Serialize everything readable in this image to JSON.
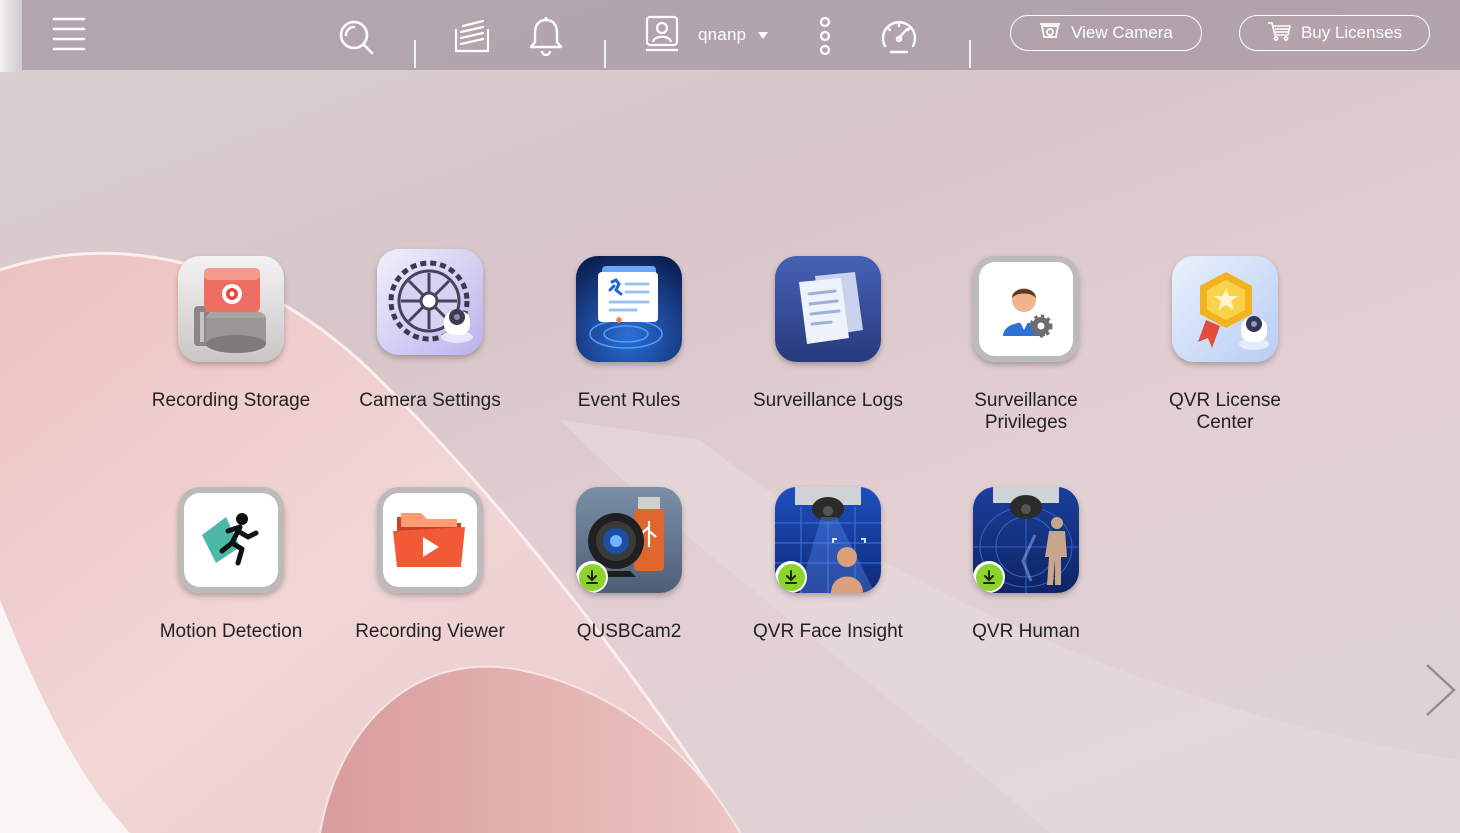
{
  "topbar": {
    "menu_icon": "hamburger-menu-icon",
    "search_icon": "search-icon",
    "tasks_icon": "background-tasks-icon",
    "notifications_icon": "bell-icon",
    "user": {
      "name": "qnanp",
      "icon": "user-icon"
    },
    "more_icon": "more-vertical-icon",
    "dashboard_icon": "dashboard-gauge-icon",
    "view_camera_label": "View Camera",
    "buy_licenses_label": "Buy Licenses"
  },
  "apps": [
    {
      "label": "Recording Storage",
      "icon": "recording-storage-icon"
    },
    {
      "label": "Camera Settings",
      "icon": "camera-settings-icon"
    },
    {
      "label": "Event Rules",
      "icon": "event-rules-icon"
    },
    {
      "label": "Surveillance Logs",
      "icon": "surveillance-logs-icon"
    },
    {
      "label": "Surveillance Privileges",
      "label_line1": "Surveillance",
      "label_line2": "Privileges",
      "icon": "surveillance-privileges-icon"
    },
    {
      "label": "QVR License Center",
      "label_line1": "QVR License",
      "label_line2": "Center",
      "icon": "qvr-license-center-icon"
    },
    {
      "label": "Motion Detection",
      "icon": "motion-detection-icon"
    },
    {
      "label": "Recording Viewer",
      "icon": "recording-viewer-icon"
    },
    {
      "label": "QUSBCam2",
      "icon": "qusbcam2-icon",
      "download": true
    },
    {
      "label": "QVR Face Insight",
      "icon": "qvr-face-insight-icon",
      "download": true
    },
    {
      "label": "QVR Human",
      "icon": "qvr-human-icon",
      "download": true
    }
  ],
  "colors": {
    "accent_download": "#8cd32c"
  },
  "next_page_icon": "chevron-right-icon"
}
